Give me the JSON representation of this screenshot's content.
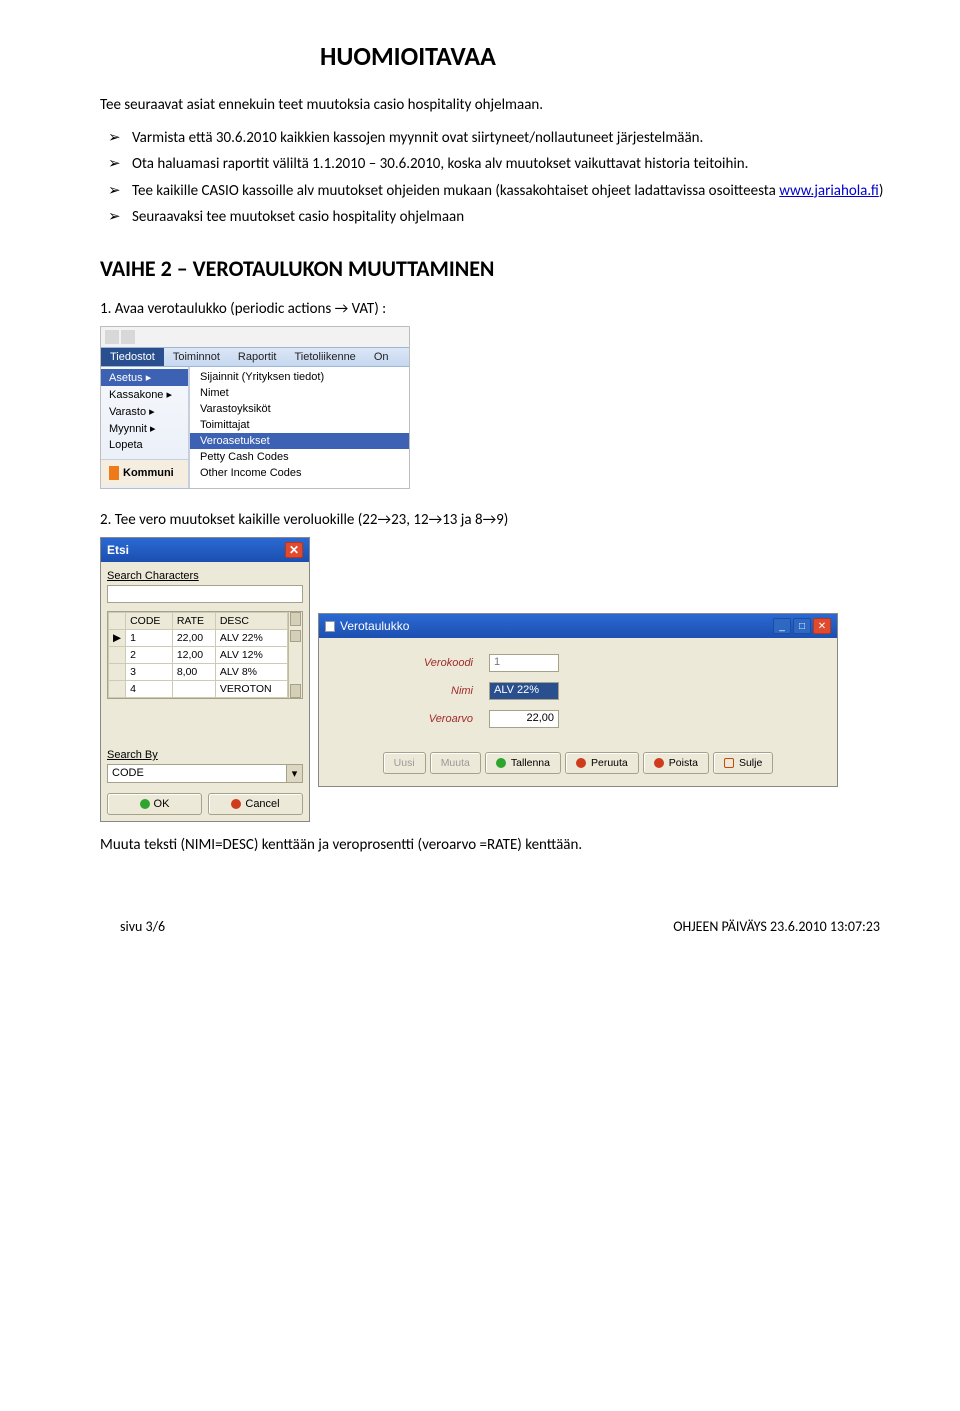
{
  "title": "HUOMIOITAVAA",
  "intro": "Tee seuraavat asiat ennekuin teet muutoksia casio hospitality ohjelmaan.",
  "bullets": {
    "b1": "Varmista että 30.6.2010 kaikkien kassojen myynnit ovat siirtyneet/nollautuneet järjestelmään.",
    "b2": "Ota haluamasi raportit väliltä 1.1.2010 – 30.6.2010, koska alv muutokset vaikuttavat historia teitoihin.",
    "b3a": "Tee kaikille CASIO kassoille alv muutokset ohjeiden mukaan (kassakohtaiset ohjeet ladattavissa osoitteesta ",
    "b3link": "www.jariahola.fi",
    "b3b": ")",
    "b4": "Seuraavaksi tee muutokset casio hospitality ohjelmaan"
  },
  "section": "VAIHE 2 – VEROTAULUKON MUUTTAMINEN",
  "step1": "1. Avaa verotaulukko (periodic actions → VAT) :",
  "step2": "2. Tee vero muutokset kaikille veroluokille (22→23, 12→13 ja 8→9)",
  "after": "Muuta teksti (NIMI=DESC) kenttään ja veroprosentti (veroarvo =RATE) kenttään.",
  "footer": {
    "left": "sivu 3/6",
    "right": "OHJEEN PÄIVÄYS 23.6.2010 13:07:23"
  },
  "shot1": {
    "menubar": [
      "Tiedostot",
      "Toiminnot",
      "Raportit",
      "Tietoliikenne",
      "On"
    ],
    "col1": [
      "Asetus",
      "Kassakone",
      "Varasto",
      "Myynnit",
      "Lopeta"
    ],
    "kommuni": "Kommuni",
    "col2": [
      "Sijainnit (Yrityksen tiedot)",
      "Nimet",
      "Varastoyksiköt",
      "Toimittajat",
      "Veroasetukset",
      "Petty Cash Codes",
      "Other Income Codes"
    ]
  },
  "etsi": {
    "title": "Etsi",
    "search_chars": "Search Characters",
    "headers": {
      "code": "CODE",
      "rate": "RATE",
      "desc": "DESC"
    },
    "rows": [
      {
        "i": "1",
        "code": "",
        "rate": "22,00",
        "desc": "ALV 22%"
      },
      {
        "i": "2",
        "code": "",
        "rate": "12,00",
        "desc": "ALV 12%"
      },
      {
        "i": "3",
        "code": "",
        "rate": "8,00",
        "desc": "ALV 8%"
      },
      {
        "i": "4",
        "code": "",
        "rate": "",
        "desc": "VEROTON"
      }
    ],
    "search_by": "Search By",
    "search_by_val": "CODE",
    "ok": "OK",
    "cancel": "Cancel"
  },
  "vero": {
    "title": "Verotaulukko",
    "labels": {
      "code": "Verokoodi",
      "name": "Nimi",
      "val": "Veroarvo"
    },
    "values": {
      "code": "1",
      "name": "ALV 22%",
      "val": "22,00"
    },
    "buttons": {
      "uusi": "Uusi",
      "muuta": "Muuta",
      "tallenna": "Tallenna",
      "peruuta": "Peruuta",
      "poista": "Poista",
      "sulje": "Sulje"
    }
  }
}
